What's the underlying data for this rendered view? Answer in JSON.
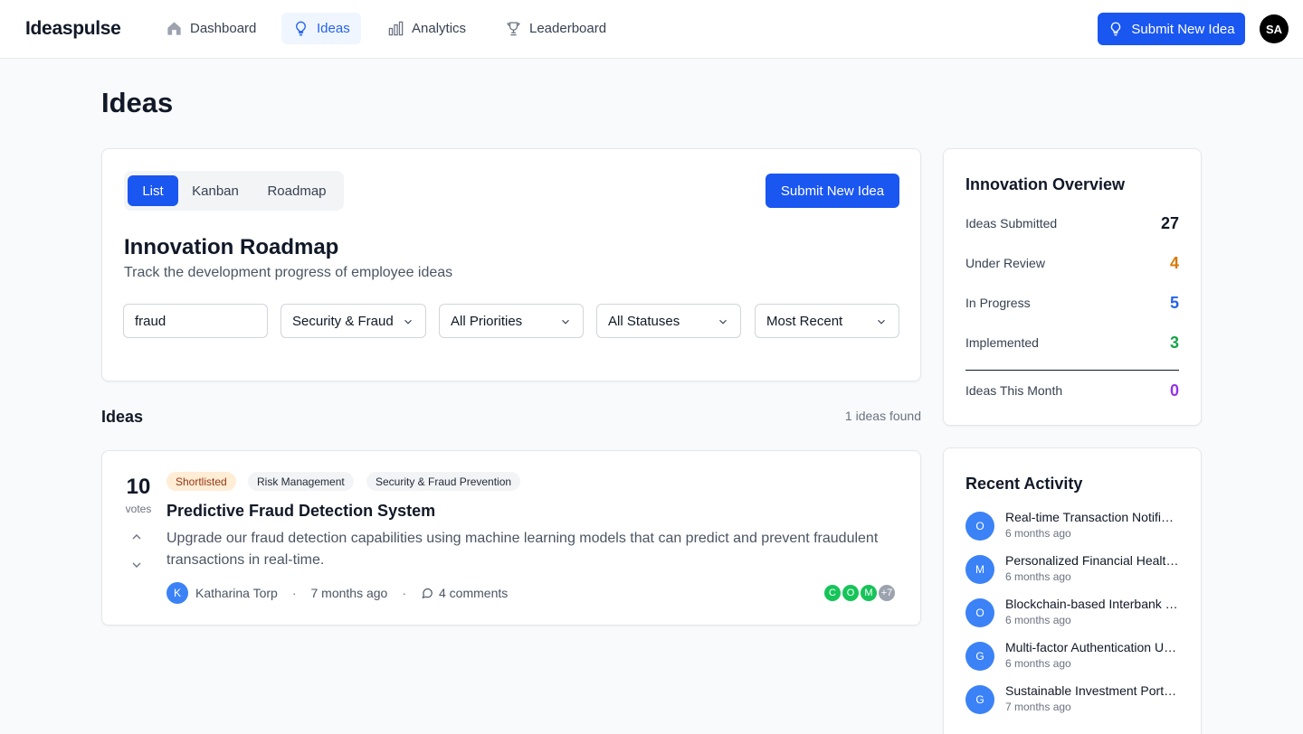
{
  "nav": {
    "brand": "Ideaspulse",
    "links": [
      {
        "label": "Dashboard",
        "icon": "home-icon"
      },
      {
        "label": "Ideas",
        "icon": "lightbulb-icon",
        "active": true
      },
      {
        "label": "Analytics",
        "icon": "bar-chart-icon"
      },
      {
        "label": "Leaderboard",
        "icon": "trophy-icon"
      }
    ],
    "submit_label": "Submit New Idea",
    "user_initials": "SA"
  },
  "page": {
    "title": "Ideas"
  },
  "controls": {
    "view_tabs": [
      "List",
      "Kanban",
      "Roadmap"
    ],
    "active_tab": "List",
    "submit_label": "Submit New Idea",
    "title": "Innovation Roadmap",
    "subtitle": "Track the development progress of employee ideas",
    "search_value": "fraud",
    "category": "Security & Fraud",
    "priority": "All Priorities",
    "status": "All Statuses",
    "sort": "Most Recent"
  },
  "ideas_section": {
    "heading": "Ideas",
    "count_text": "1 ideas found"
  },
  "idea": {
    "votes": "10",
    "votes_label": "votes",
    "tags": [
      "Shortlisted",
      "Risk Management",
      "Security & Fraud Prevention"
    ],
    "title": "Predictive Fraud Detection System",
    "description": "Upgrade our fraud detection capabilities using machine learning models that can predict and prevent fraudulent transactions in real-time.",
    "author_initial": "K",
    "author": "Katharina Torp",
    "time": "7 months ago",
    "comments": "4 comments",
    "voters": [
      "C",
      "O",
      "M"
    ],
    "more_voters": "+7",
    "colors": {
      "voter": "#16c45a",
      "more": "#9ca3af"
    }
  },
  "overview": {
    "title": "Innovation Overview",
    "rows": [
      {
        "label": "Ideas Submitted",
        "value": "27",
        "color": "#111827"
      },
      {
        "label": "Under Review",
        "value": "4",
        "color": "#d97706"
      },
      {
        "label": "In Progress",
        "value": "5",
        "color": "#2563eb"
      },
      {
        "label": "Implemented",
        "value": "3",
        "color": "#16a34a"
      }
    ],
    "month": {
      "label": "Ideas This Month",
      "value": "0",
      "color": "#9333ea"
    }
  },
  "activity": {
    "title": "Recent Activity",
    "items": [
      {
        "initial": "O",
        "title": "Real-time Transaction Notifications",
        "time": "6 months ago"
      },
      {
        "initial": "M",
        "title": "Personalized Financial Health Dashboard",
        "time": "6 months ago"
      },
      {
        "initial": "O",
        "title": "Blockchain-based Interbank Settlement",
        "time": "6 months ago"
      },
      {
        "initial": "G",
        "title": "Multi-factor Authentication Upgrade",
        "time": "6 months ago"
      },
      {
        "initial": "G",
        "title": "Sustainable Investment Portfolio",
        "time": "7 months ago"
      }
    ]
  }
}
